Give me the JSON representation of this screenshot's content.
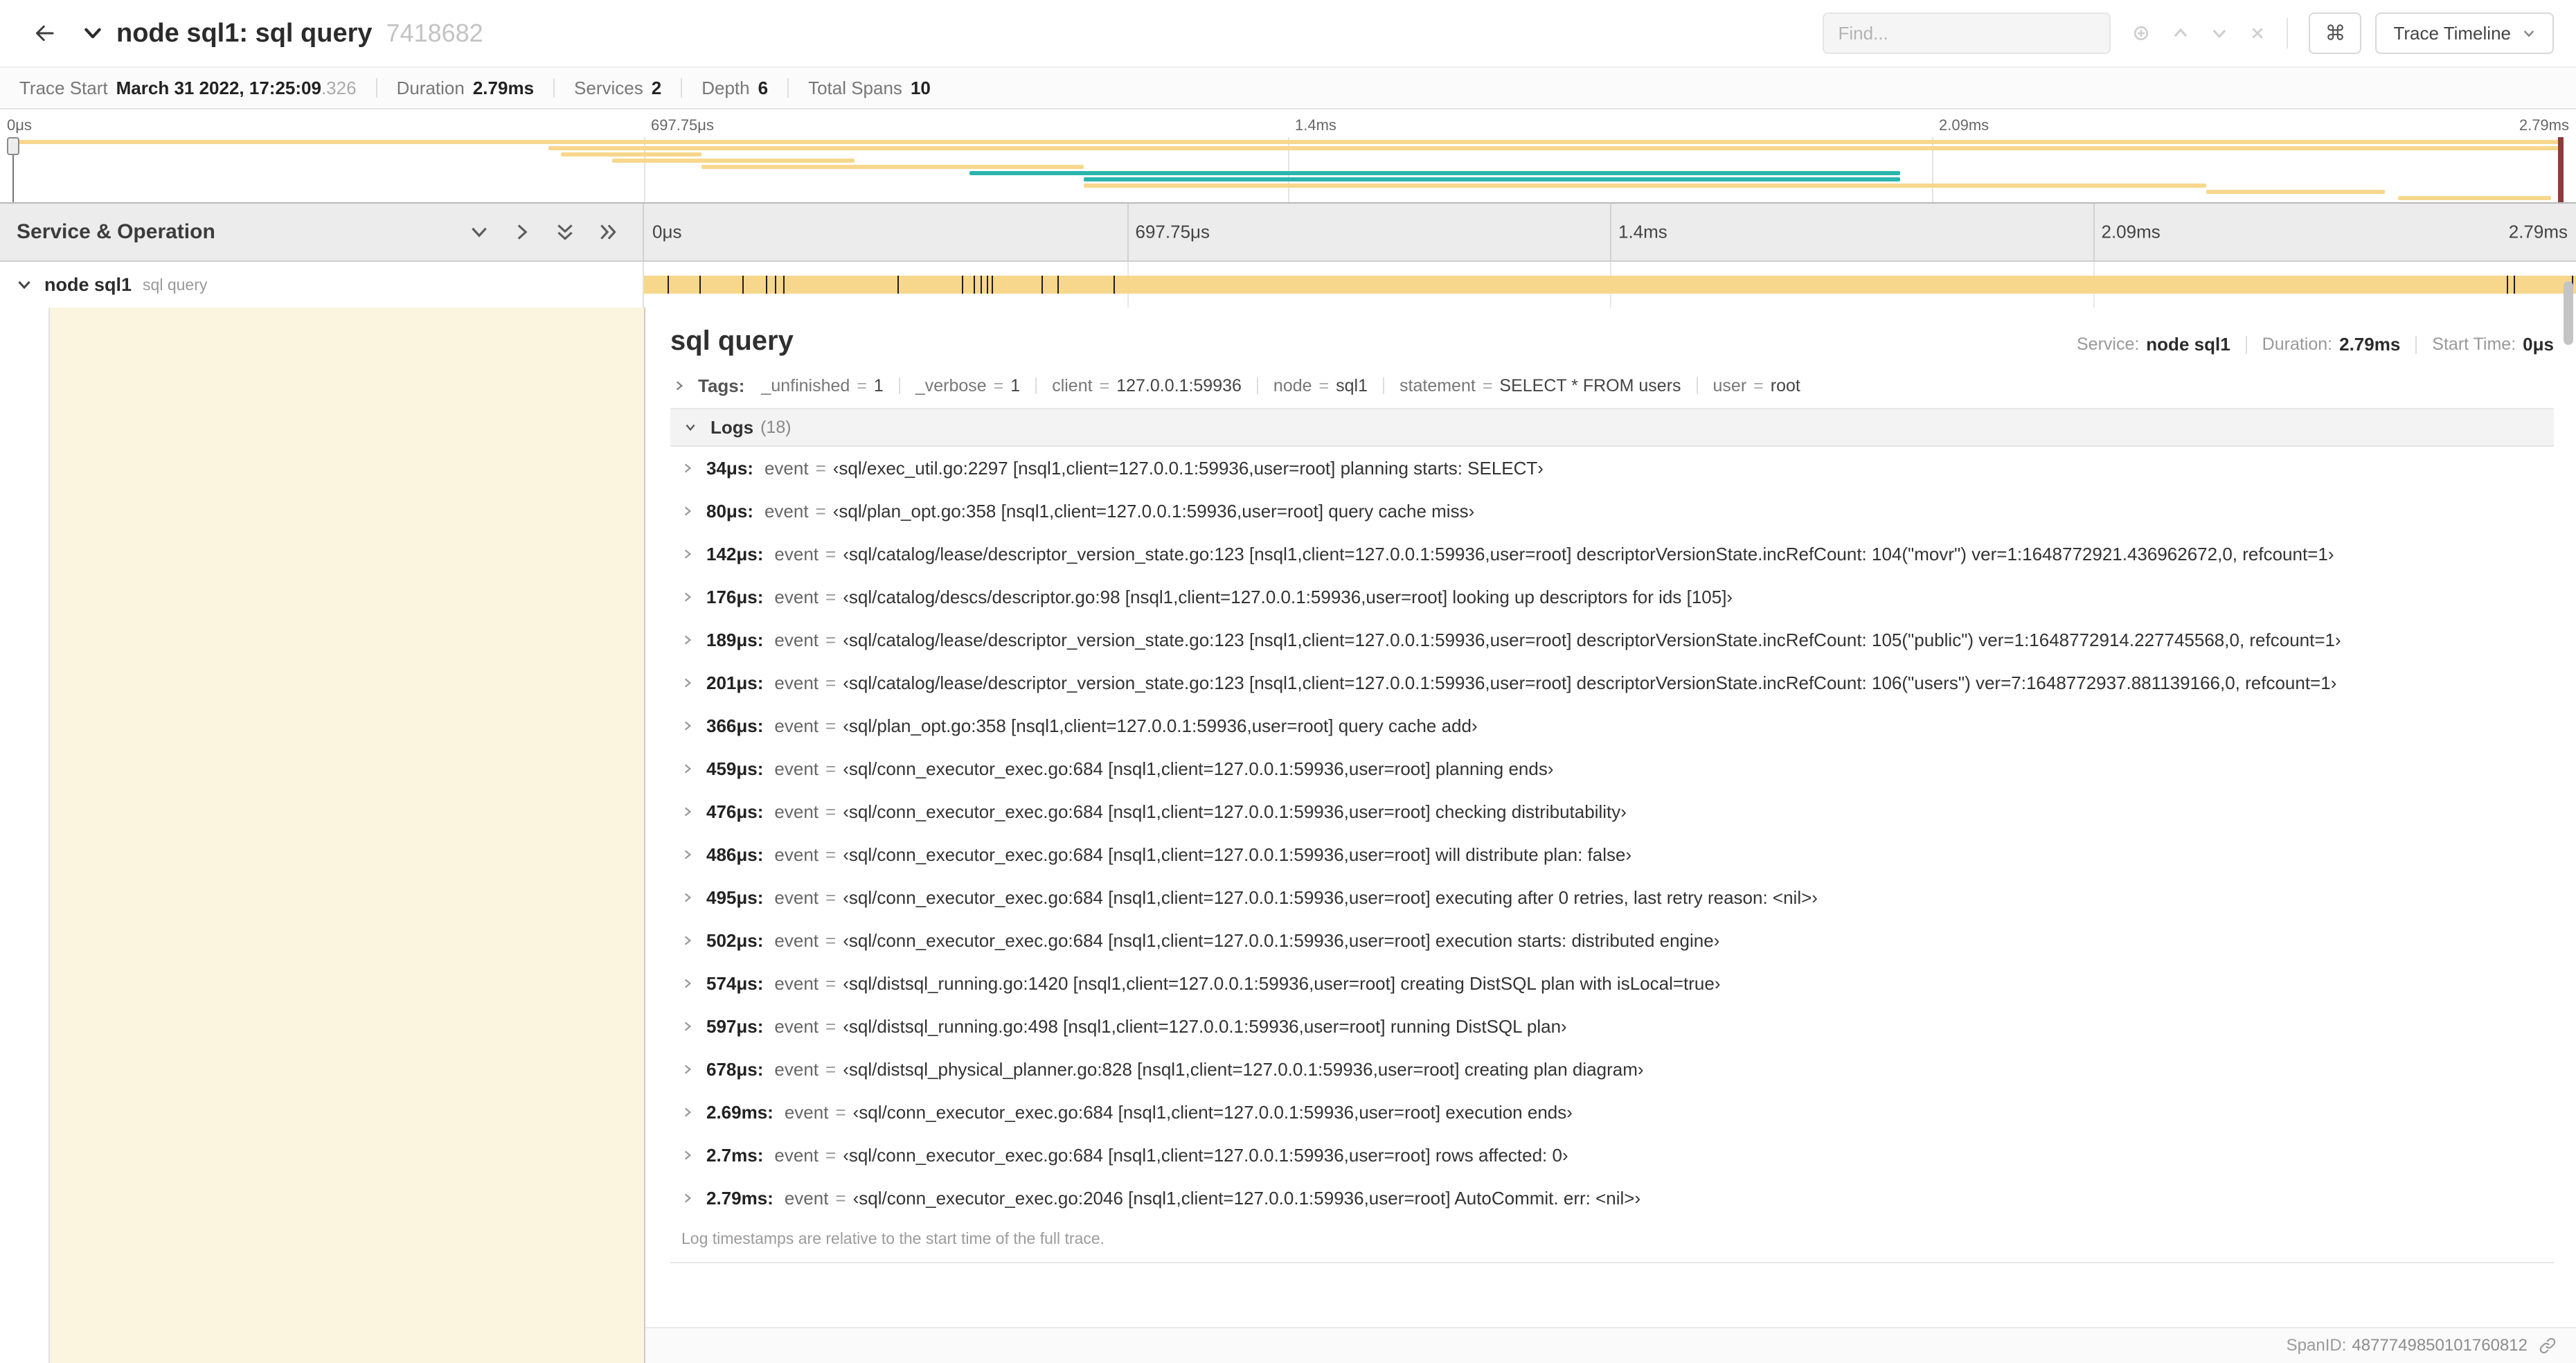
{
  "header": {
    "title": "node sql1: sql query",
    "trace_id": "7418682",
    "find_placeholder": "Find...",
    "shortcut_button": "⌘",
    "view_options_button": "Trace Timeline"
  },
  "summary": {
    "items": [
      {
        "label": "Trace Start",
        "value": "March 31 2022, 17:25:09",
        "suffix": ".326"
      },
      {
        "label": "Duration",
        "value": "2.79ms"
      },
      {
        "label": "Services",
        "value": "2"
      },
      {
        "label": "Depth",
        "value": "6"
      },
      {
        "label": "Total Spans",
        "value": "10"
      }
    ]
  },
  "minimap": {
    "ticks": [
      "0μs",
      "697.75μs",
      "1.4ms",
      "2.09ms",
      "2.79ms"
    ],
    "colors": {
      "tan": "#F7D78C",
      "teal": "#2BB5AC"
    },
    "bars": [
      {
        "start": 0,
        "end": 100,
        "color": "tan"
      },
      {
        "start": 21,
        "end": 100,
        "color": "tan"
      },
      {
        "start": 21.5,
        "end": 27,
        "color": "tan"
      },
      {
        "start": 23.5,
        "end": 33,
        "color": "tan"
      },
      {
        "start": 27,
        "end": 42,
        "color": "tan"
      },
      {
        "start": 37.5,
        "end": 74,
        "color": "teal"
      },
      {
        "start": 42,
        "end": 74,
        "color": "teal"
      },
      {
        "start": 42,
        "end": 86,
        "color": "tan"
      },
      {
        "start": 86,
        "end": 93,
        "color": "tan"
      },
      {
        "start": 93.5,
        "end": 99.5,
        "color": "tan"
      }
    ]
  },
  "timeline": {
    "left_header": "Service & Operation",
    "ticks": [
      "0μs",
      "697.75μs",
      "1.4ms",
      "2.09ms",
      "2.79ms"
    ],
    "span_row": {
      "service": "node sql1",
      "operation": "sql query",
      "bar_start_pct": 0,
      "bar_end_pct": 100,
      "log_marker_positions": [
        1.22,
        2.87,
        5.09,
        6.31,
        6.77,
        7.2,
        13.12,
        16.45,
        17.06,
        17.42,
        17.74,
        17.99,
        20.57,
        21.4,
        24.3,
        96.42,
        96.77,
        99.8
      ]
    }
  },
  "detail": {
    "accent_color": "#FBF4DE",
    "eq_sign": "=",
    "title": "sql query",
    "service_label": "Service:",
    "service_value": "node sql1",
    "duration_label": "Duration:",
    "duration_value": "2.79ms",
    "start_label": "Start Time:",
    "start_value": "0μs",
    "tags_label": "Tags:",
    "tags": [
      {
        "key": "_unfinished",
        "value": "1"
      },
      {
        "key": "_verbose",
        "value": "1"
      },
      {
        "key": "client",
        "value": "127.0.0.1:59936"
      },
      {
        "key": "node",
        "value": "sql1"
      },
      {
        "key": "statement",
        "value": "SELECT * FROM users"
      },
      {
        "key": "user",
        "value": "root"
      }
    ],
    "logs_label": "Logs",
    "logs_count": "(18)",
    "logs": [
      {
        "time": "34μs:",
        "field": "event",
        "value": "‹sql/exec_util.go:2297 [nsql1,client=127.0.0.1:59936,user=root] planning starts: SELECT›"
      },
      {
        "time": "80μs:",
        "field": "event",
        "value": "‹sql/plan_opt.go:358 [nsql1,client=127.0.0.1:59936,user=root] query cache miss›"
      },
      {
        "time": "142μs:",
        "field": "event",
        "value": "‹sql/catalog/lease/descriptor_version_state.go:123 [nsql1,client=127.0.0.1:59936,user=root] descriptorVersionState.incRefCount: 104(\"movr\") ver=1:1648772921.436962672,0, refcount=1›"
      },
      {
        "time": "176μs:",
        "field": "event",
        "value": "‹sql/catalog/descs/descriptor.go:98 [nsql1,client=127.0.0.1:59936,user=root] looking up descriptors for ids [105]›"
      },
      {
        "time": "189μs:",
        "field": "event",
        "value": "‹sql/catalog/lease/descriptor_version_state.go:123 [nsql1,client=127.0.0.1:59936,user=root] descriptorVersionState.incRefCount: 105(\"public\") ver=1:1648772914.227745568,0, refcount=1›"
      },
      {
        "time": "201μs:",
        "field": "event",
        "value": "‹sql/catalog/lease/descriptor_version_state.go:123 [nsql1,client=127.0.0.1:59936,user=root] descriptorVersionState.incRefCount: 106(\"users\") ver=7:1648772937.881139166,0, refcount=1›"
      },
      {
        "time": "366μs:",
        "field": "event",
        "value": "‹sql/plan_opt.go:358 [nsql1,client=127.0.0.1:59936,user=root] query cache add›"
      },
      {
        "time": "459μs:",
        "field": "event",
        "value": "‹sql/conn_executor_exec.go:684 [nsql1,client=127.0.0.1:59936,user=root] planning ends›"
      },
      {
        "time": "476μs:",
        "field": "event",
        "value": "‹sql/conn_executor_exec.go:684 [nsql1,client=127.0.0.1:59936,user=root] checking distributability›"
      },
      {
        "time": "486μs:",
        "field": "event",
        "value": "‹sql/conn_executor_exec.go:684 [nsql1,client=127.0.0.1:59936,user=root] will distribute plan: false›"
      },
      {
        "time": "495μs:",
        "field": "event",
        "value": "‹sql/conn_executor_exec.go:684 [nsql1,client=127.0.0.1:59936,user=root] executing after 0 retries, last retry reason: <nil>›"
      },
      {
        "time": "502μs:",
        "field": "event",
        "value": "‹sql/conn_executor_exec.go:684 [nsql1,client=127.0.0.1:59936,user=root] execution starts: distributed engine›"
      },
      {
        "time": "574μs:",
        "field": "event",
        "value": "‹sql/distsql_running.go:1420 [nsql1,client=127.0.0.1:59936,user=root] creating DistSQL plan with isLocal=true›"
      },
      {
        "time": "597μs:",
        "field": "event",
        "value": "‹sql/distsql_running.go:498 [nsql1,client=127.0.0.1:59936,user=root] running DistSQL plan›"
      },
      {
        "time": "678μs:",
        "field": "event",
        "value": "‹sql/distsql_physical_planner.go:828 [nsql1,client=127.0.0.1:59936,user=root] creating plan diagram›"
      },
      {
        "time": "2.69ms:",
        "field": "event",
        "value": "‹sql/conn_executor_exec.go:684 [nsql1,client=127.0.0.1:59936,user=root] execution ends›"
      },
      {
        "time": "2.7ms:",
        "field": "event",
        "value": "‹sql/conn_executor_exec.go:684 [nsql1,client=127.0.0.1:59936,user=root] rows affected: 0›"
      },
      {
        "time": "2.79ms:",
        "field": "event",
        "value": "‹sql/conn_executor_exec.go:2046 [nsql1,client=127.0.0.1:59936,user=root] AutoCommit. err: <nil>›"
      }
    ],
    "logs_footnote": "Log timestamps are relative to the start time of the full trace.",
    "span_id_label": "SpanID:",
    "span_id": "4877749850101760812"
  }
}
